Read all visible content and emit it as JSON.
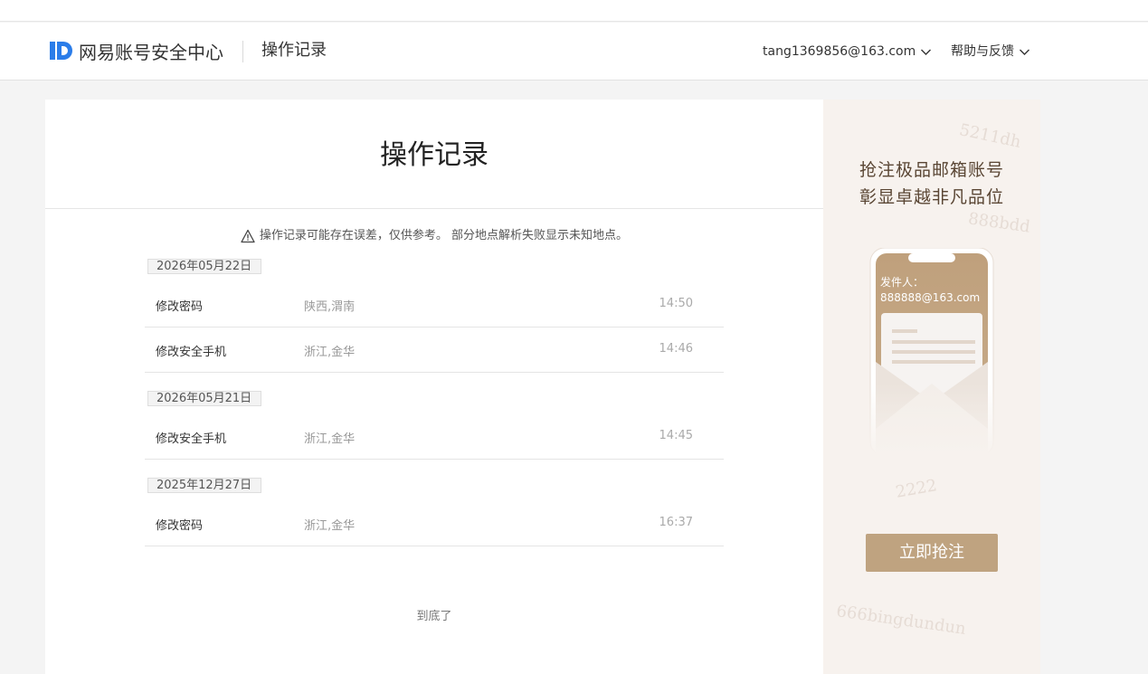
{
  "header": {
    "brand": "网易账号安全中心",
    "page": "操作记录",
    "account": "tang1369856@163.com",
    "help": "帮助与反馈"
  },
  "card": {
    "title": "操作记录",
    "notice": "操作记录可能存在误差，仅供参考。 部分地点解析失败显示未知地点。",
    "groups": [
      {
        "date": "2026年05月22日",
        "records": [
          {
            "op": "修改密码",
            "loc": "陕西,渭南",
            "time": "14:50"
          },
          {
            "op": "修改安全手机",
            "loc": "浙江,金华",
            "time": "14:46"
          }
        ]
      },
      {
        "date": "2026年05月21日",
        "records": [
          {
            "op": "修改安全手机",
            "loc": "浙江,金华",
            "time": "14:45"
          }
        ]
      },
      {
        "date": "2025年12月27日",
        "records": [
          {
            "op": "修改密码",
            "loc": "浙江,金华",
            "time": "16:37"
          }
        ]
      }
    ],
    "bottom_text": "到底了"
  },
  "ad": {
    "line1": "抢注极品邮箱账号",
    "line2": "彰显卓越非凡品位",
    "sender_label": "发件人：",
    "sender_email": "888888@163.com",
    "button": "立即抢注",
    "watermarks": [
      "5211dh",
      "888bdd",
      "2222",
      "666bingdundun"
    ]
  },
  "colors": {
    "brand_blue": "#2b7de9",
    "ad_gold": "#bfa380",
    "ad_bg": "#f7f2ee"
  }
}
